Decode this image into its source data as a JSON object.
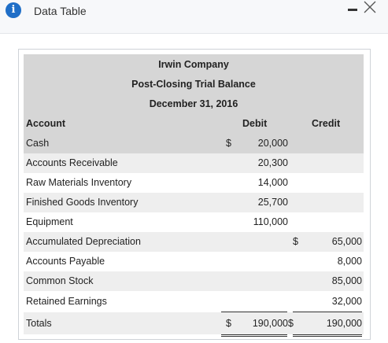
{
  "window": {
    "title": "Data Table",
    "info_icon": "info-icon",
    "minimize_icon": "minimize-icon",
    "close_icon": "close-icon"
  },
  "report": {
    "company": "Irwin Company",
    "statement": "Post-Closing Trial Balance",
    "date": "December 31, 2016"
  },
  "columns": {
    "account": "Account",
    "debit": "Debit",
    "credit": "Credit"
  },
  "rows": [
    {
      "account": "Cash",
      "debit_currency": "$",
      "debit": "20,000",
      "credit_currency": "",
      "credit": ""
    },
    {
      "account": "Accounts Receivable",
      "debit_currency": "",
      "debit": "20,300",
      "credit_currency": "",
      "credit": ""
    },
    {
      "account": "Raw Materials Inventory",
      "debit_currency": "",
      "debit": "14,000",
      "credit_currency": "",
      "credit": ""
    },
    {
      "account": "Finished Goods Inventory",
      "debit_currency": "",
      "debit": "25,700",
      "credit_currency": "",
      "credit": ""
    },
    {
      "account": "Equipment",
      "debit_currency": "",
      "debit": "110,000",
      "credit_currency": "",
      "credit": ""
    },
    {
      "account": "Accumulated Depreciation",
      "debit_currency": "",
      "debit": "",
      "credit_currency": "$",
      "credit": "65,000"
    },
    {
      "account": "Accounts Payable",
      "debit_currency": "",
      "debit": "",
      "credit_currency": "",
      "credit": "8,000"
    },
    {
      "account": "Common Stock",
      "debit_currency": "",
      "debit": "",
      "credit_currency": "",
      "credit": "85,000"
    },
    {
      "account": "Retained Earnings",
      "debit_currency": "",
      "debit": "",
      "credit_currency": "",
      "credit": "32,000"
    }
  ],
  "totals": {
    "label": "Totals",
    "debit_currency": "$",
    "debit": "190,000",
    "credit_currency": "$",
    "credit": "190,000"
  }
}
